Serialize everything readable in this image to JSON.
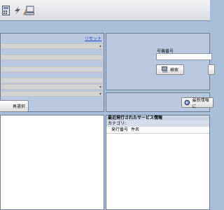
{
  "toolbar": {
    "icons": [
      "calculator-icon",
      "lightning-icon",
      "pencil-computer-icon"
    ]
  },
  "filter_panel": {
    "reset_link": "リセット",
    "combos": [
      {
        "value": ""
      },
      {
        "value": ""
      },
      {
        "value": ""
      },
      {
        "value": ""
      },
      {
        "value": ""
      },
      {
        "value": ""
      }
    ],
    "reselect_button": "再選択"
  },
  "machine_panel": {
    "machine_number_label": "号機番号",
    "machine_number_value": "",
    "search_button": "検索"
  },
  "latest_panel": {
    "refresh_button": "最新情報に"
  },
  "service_info": {
    "header": "最近発行されたサービス情報",
    "category_label": "カテゴリ:",
    "columns": [
      "発行番号",
      "件名"
    ]
  },
  "colors": {
    "background": "#a9bdd8",
    "panel": "#b9c8df",
    "link": "#1a3fbf"
  }
}
